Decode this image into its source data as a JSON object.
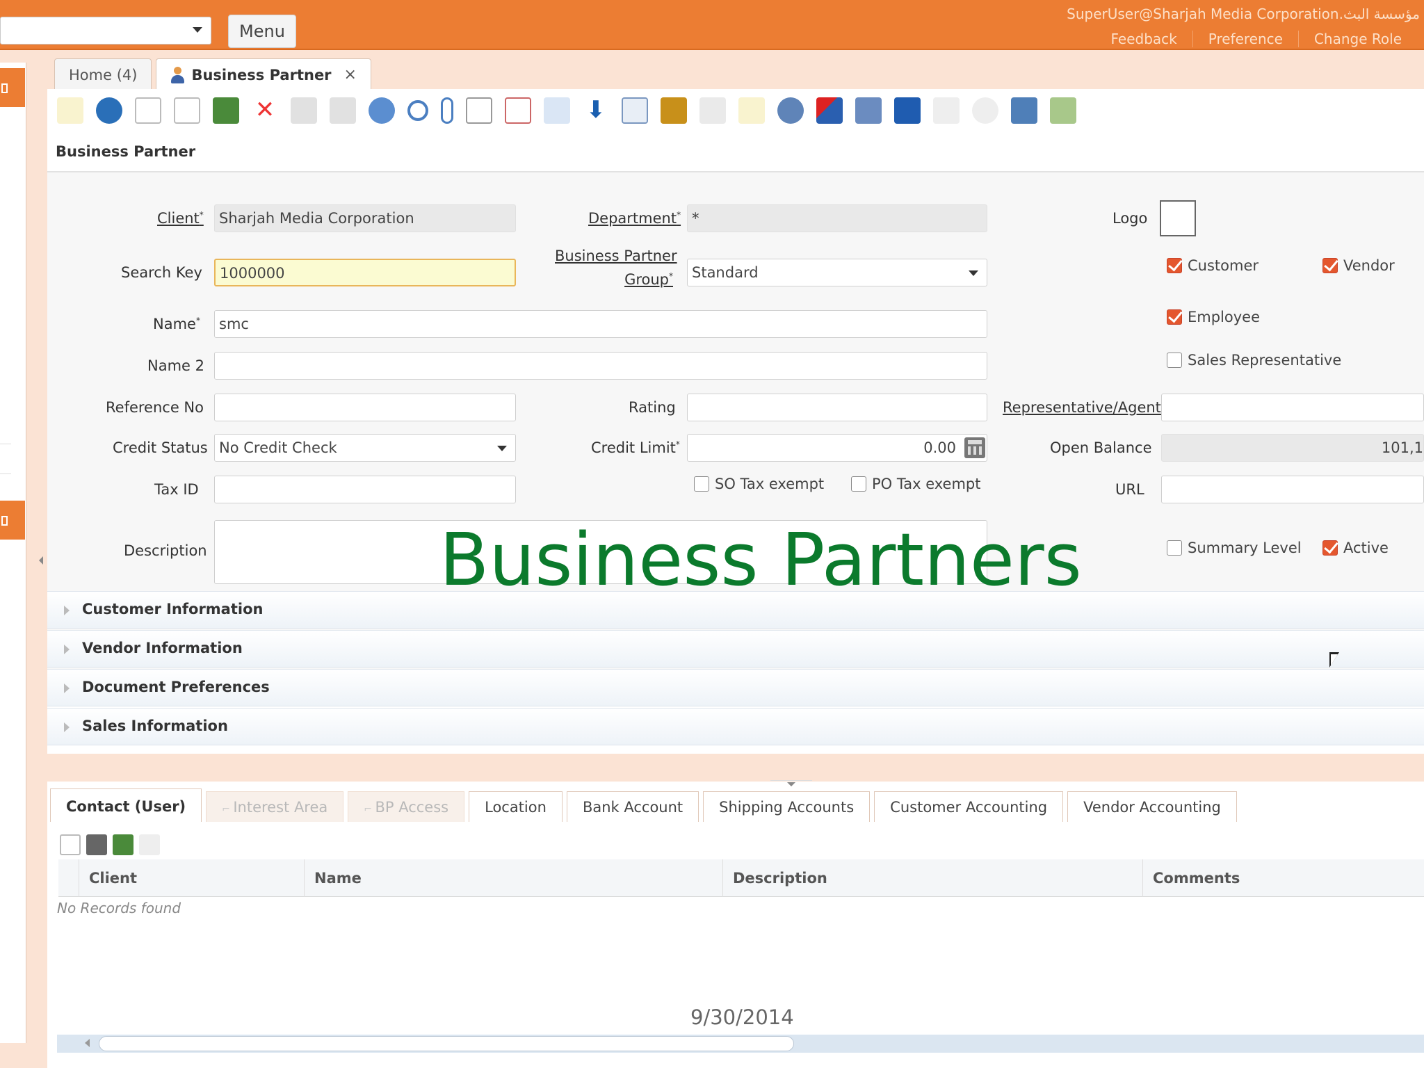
{
  "header": {
    "menu_label": "Menu",
    "user_line": "SuperUser@Sharjah Media Corporation.مؤسسة البث",
    "links": [
      "Feedback",
      "Preference",
      "Change Role"
    ]
  },
  "tabs": {
    "home": "Home (4)",
    "active": "Business Partner",
    "close_glyph": "×"
  },
  "window_title": "Business Partner",
  "form": {
    "client_label": "Client",
    "client_value": "Sharjah Media Corporation",
    "department_label": "Department",
    "department_value": "*",
    "logo_label": "Logo",
    "search_key_label": "Search Key",
    "search_key_value": "1000000",
    "bp_group_label_1": "Business Partner",
    "bp_group_label_2": "Group",
    "bp_group_value": "Standard",
    "name_label": "Name",
    "name_value": "smc",
    "name2_label": "Name 2",
    "name2_value": "",
    "reference_no_label": "Reference No",
    "reference_no_value": "",
    "rating_label": "Rating",
    "rating_value": "",
    "rep_agent_label": "Representative/Agent",
    "rep_agent_value": "",
    "credit_status_label": "Credit Status",
    "credit_status_value": "No Credit Check",
    "credit_limit_label": "Credit Limit",
    "credit_limit_value": "0.00",
    "open_balance_label": "Open Balance",
    "open_balance_value": "101,1",
    "tax_id_label": "Tax ID",
    "tax_id_value": "",
    "so_tax_exempt_label": "SO Tax exempt",
    "po_tax_exempt_label": "PO Tax exempt",
    "url_label": "URL",
    "url_value": "",
    "description_label": "Description",
    "description_value": "",
    "checkboxes": {
      "customer": "Customer",
      "vendor": "Vendor",
      "employee": "Employee",
      "sales_rep": "Sales Representative",
      "summary_level": "Summary Level",
      "active": "Active"
    },
    "checked": {
      "customer": true,
      "vendor": true,
      "employee": true,
      "sales_rep": false,
      "summary_level": false,
      "active": true,
      "so_tax_exempt": false,
      "po_tax_exempt": false
    }
  },
  "overlay_title": "Business Partners",
  "sections": [
    "Customer Information",
    "Vendor Information",
    "Document Preferences",
    "Sales Information"
  ],
  "sub_tabs": [
    "Contact (User)",
    "Interest Area",
    "BP Access",
    "Location",
    "Bank Account",
    "Shipping Accounts",
    "Customer Accounting",
    "Vendor Accounting"
  ],
  "grid": {
    "columns": [
      "Client",
      "Name",
      "Description",
      "Comments"
    ],
    "empty_text": "No Records found"
  },
  "date_stamp": "9/30/2014",
  "colors": {
    "header_orange": "#ec7d33",
    "checkbox_checked": "#e4572e",
    "overlay_green": "#0b7a2c",
    "focus_field": "#fbfbd2"
  }
}
